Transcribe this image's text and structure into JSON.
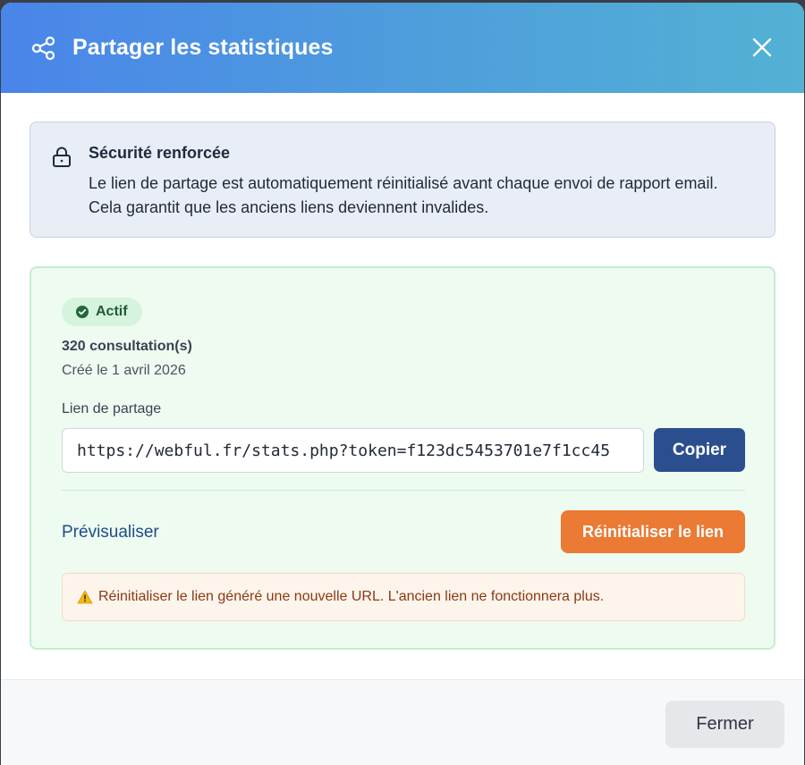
{
  "modal": {
    "title": "Partager les statistiques",
    "header_icon": "share-icon",
    "close_icon": "close-icon"
  },
  "security_notice": {
    "icon": "lock-icon",
    "title": "Sécurité renforcée",
    "text": "Le lien de partage est automatiquement réinitialisé avant chaque envoi de rapport email. Cela garantit que les anciens liens deviennent invalides."
  },
  "share_link": {
    "status_badge": "Actif",
    "status_icon": "check-circle-icon",
    "views": "320 consultation(s)",
    "created": "Créé le 1 avril 2026",
    "label": "Lien de partage",
    "url": "https://webful.fr/stats.php?token=f123dc5453701e7f1cc45",
    "copy_label": "Copier",
    "preview_label": "Prévisualiser",
    "reset_label": "Réinitialiser le lien",
    "warning_icon": "warning-icon",
    "warning_text": "Réinitialiser le lien généré une nouvelle URL. L'ancien lien ne fonctionnera plus."
  },
  "footer": {
    "close_label": "Fermer"
  },
  "colors": {
    "header_gradient_start": "#4a85ea",
    "header_gradient_end": "#53b1d4",
    "copy_button": "#2b4f8e",
    "reset_button": "#ea7a34",
    "status_green": "#1f5a33",
    "card_background": "#eefbf1"
  }
}
